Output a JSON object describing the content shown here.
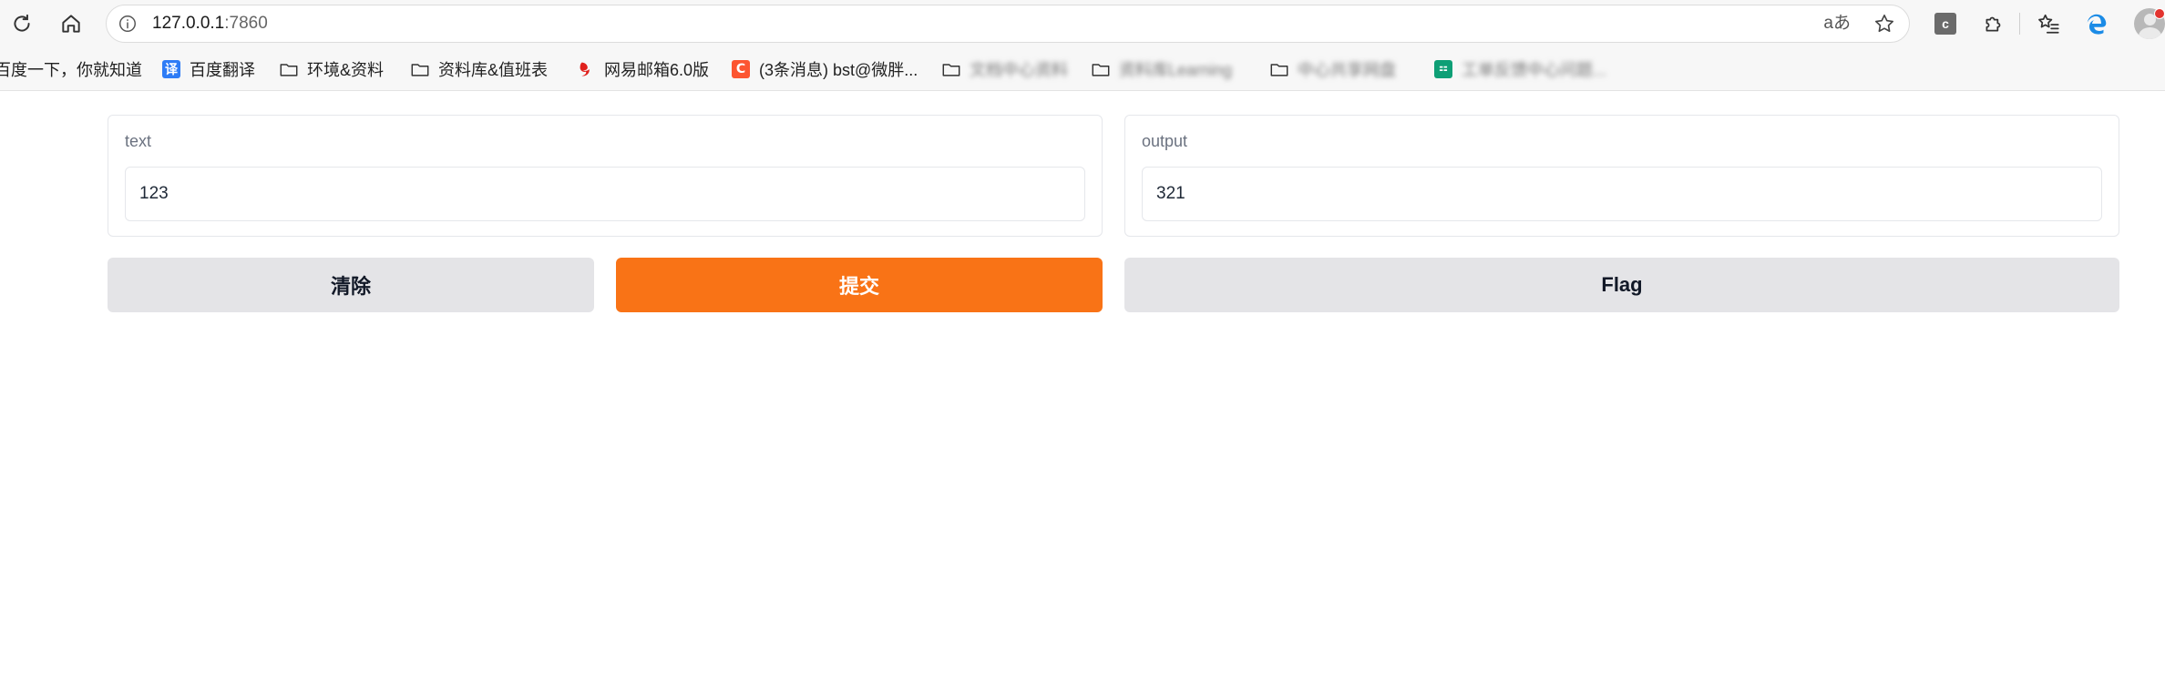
{
  "browser": {
    "url_host": "127.0.0.1",
    "url_port": ":7860",
    "read_aloud_label": "aあ",
    "extension_letter": "c"
  },
  "bookmarks": [
    {
      "label": "百度一下，你就知道",
      "icon": "none"
    },
    {
      "label": "百度翻译",
      "icon": "baidu-translate-icon",
      "icon_text": "译",
      "color": "#2e7cf6"
    },
    {
      "label": "环境&资料",
      "icon": "folder-icon"
    },
    {
      "label": "资料库&值班表",
      "icon": "folder-icon"
    },
    {
      "label": "网易邮箱6.0版",
      "icon": "netease-mail-icon",
      "color": "#e0201c"
    },
    {
      "label": "(3条消息) bst@微胖...",
      "icon": "csdn-icon",
      "icon_text": "C",
      "color": "#fc5531"
    },
    {
      "label": "文档中心资料",
      "icon": "folder-icon"
    },
    {
      "label": "资料库Learning",
      "icon": "folder-icon"
    },
    {
      "label": "中心共享网盘",
      "icon": "folder-icon"
    },
    {
      "label": "工单反馈中心问题...",
      "icon": "app-icon",
      "color": "#0e9f76"
    }
  ],
  "form": {
    "input_label": "text",
    "input_value": "123",
    "output_label": "output",
    "output_value": "321"
  },
  "buttons": {
    "clear": "清除",
    "submit": "提交",
    "flag": "Flag"
  },
  "colors": {
    "primary": "#f97316",
    "secondary": "#e4e4e7"
  }
}
